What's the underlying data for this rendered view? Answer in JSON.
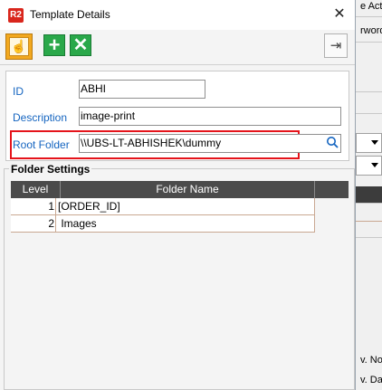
{
  "background": {
    "top_text": "e Acti",
    "second_text": "rword",
    "bottom_text_1": "v. No",
    "bottom_text_2": "v. Da"
  },
  "window": {
    "app_icon": "R2",
    "title": "Template Details",
    "close_glyph": "✕"
  },
  "toolbar": {
    "select_icon": "hand-pointer-icon",
    "add_icon": "plus-icon",
    "delete_icon": "x-icon",
    "exit_icon": "exit-icon"
  },
  "form": {
    "id_label": "ID",
    "id_value": "ABHI",
    "description_label": "Description",
    "description_value": "image-print",
    "root_folder_label": "Root Folder",
    "root_folder_value": "\\\\UBS-LT-ABHISHEK\\dummy"
  },
  "folder_settings": {
    "title": "Folder Settings",
    "columns": [
      "Level",
      "Folder Name"
    ],
    "rows": [
      {
        "level": "1",
        "name": "[ORDER_ID]"
      },
      {
        "level": "2",
        "name": " Images"
      }
    ]
  },
  "colors": {
    "label_blue": "#1565c0",
    "highlight_red": "#e5141b",
    "header_dark": "#4b4b4b",
    "add_green": "#2aa84a",
    "hand_orange": "#f2a81f"
  }
}
